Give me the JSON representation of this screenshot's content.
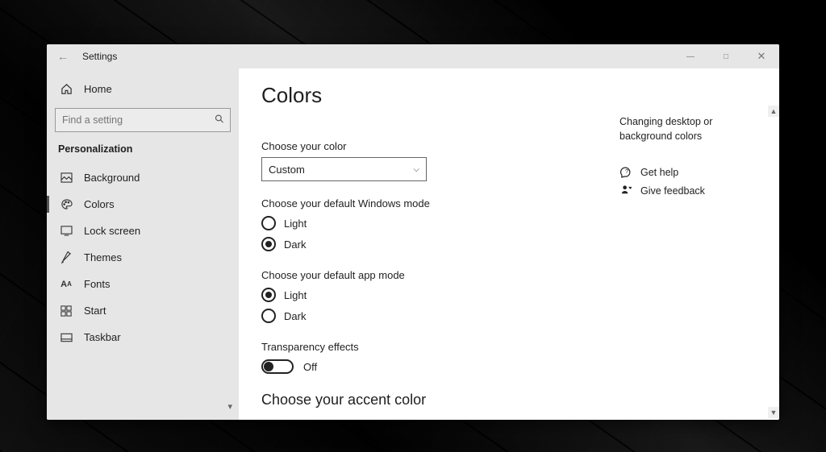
{
  "window": {
    "title": "Settings"
  },
  "sidebar": {
    "home": "Home",
    "search_placeholder": "Find a setting",
    "section": "Personalization",
    "items": [
      {
        "label": "Background",
        "selected": false
      },
      {
        "label": "Colors",
        "selected": true
      },
      {
        "label": "Lock screen",
        "selected": false
      },
      {
        "label": "Themes",
        "selected": false
      },
      {
        "label": "Fonts",
        "selected": false
      },
      {
        "label": "Start",
        "selected": false
      },
      {
        "label": "Taskbar",
        "selected": false
      }
    ]
  },
  "main": {
    "heading": "Colors",
    "choose_color_label": "Choose your color",
    "choose_color_value": "Custom",
    "windows_mode_label": "Choose your default Windows mode",
    "windows_mode": {
      "light": "Light",
      "dark": "Dark",
      "selected": "dark"
    },
    "app_mode_label": "Choose your default app mode",
    "app_mode": {
      "light": "Light",
      "dark": "Dark",
      "selected": "light"
    },
    "transparency_label": "Transparency effects",
    "transparency_state": "Off",
    "accent_heading": "Choose your accent color"
  },
  "right": {
    "tip": "Changing desktop or background colors",
    "help": "Get help",
    "feedback": "Give feedback"
  }
}
